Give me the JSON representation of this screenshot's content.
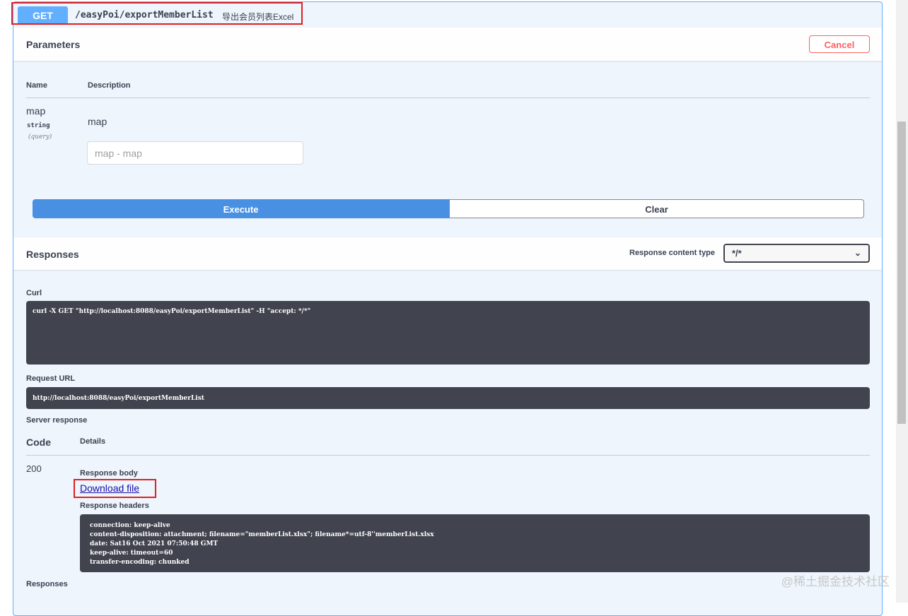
{
  "operation": {
    "method": "GET",
    "path": "/easyPoi/exportMemberList",
    "summary": "导出会员列表Excel"
  },
  "parameters": {
    "title": "Parameters",
    "cancel_label": "Cancel",
    "columns": {
      "name": "Name",
      "description": "Description"
    },
    "items": [
      {
        "name": "map",
        "type": "string",
        "in": "(query)",
        "description": "map",
        "placeholder": "map - map"
      }
    ],
    "execute_label": "Execute",
    "clear_label": "Clear"
  },
  "responses_section": {
    "title": "Responses",
    "content_type_label": "Response content type",
    "content_type_value": "*/*",
    "curl_label": "Curl",
    "curl_command": "curl -X GET \"http://localhost:8088/easyPoi/exportMemberList\" -H \"accept: */*\"",
    "request_url_label": "Request URL",
    "request_url": "http://localhost:8088/easyPoi/exportMemberList",
    "server_response_label": "Server response",
    "code_col": "Code",
    "details_col": "Details",
    "code": "200",
    "body_label": "Response body",
    "download_label": "Download file",
    "headers_label": "Response headers",
    "headers": [
      "connection: keep-alive",
      "content-disposition: attachment; filename=\"memberList.xlsx\"; filename*=utf-8''memberList.xlsx",
      "date: Sat16 Oct 2021 07:50:48 GMT",
      "keep-alive: timeout=60",
      "transfer-encoding: chunked"
    ],
    "footer_responses_label": "Responses"
  },
  "watermark": "@稀土掘金技术社区"
}
